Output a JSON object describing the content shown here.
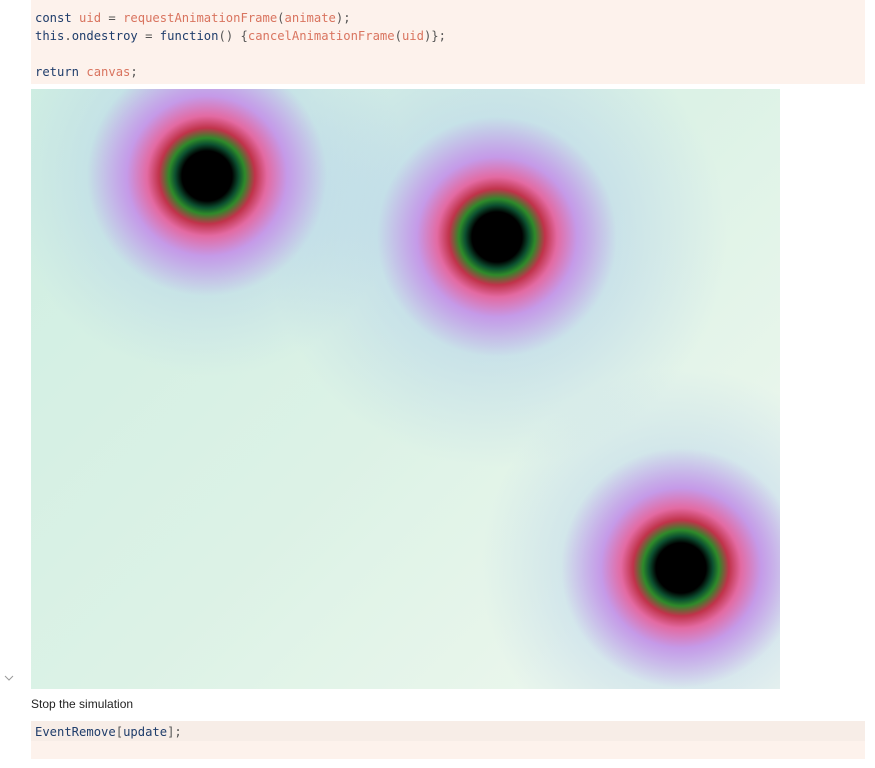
{
  "code_cell_1": {
    "line1_const": "const",
    "line1_uid": "uid",
    "line1_eq": "=",
    "line1_fn": "requestAnimationFrame",
    "line1_arg": "animate",
    "line2_this": "this",
    "line2_prop": "ondestroy",
    "line2_eq": "=",
    "line2_function": "function",
    "line2_paren": "()",
    "line2_cancel": "cancelAnimationFrame",
    "line2_arg": "uid",
    "line3_return": "return",
    "line3_canvas": "canvas"
  },
  "output_canvas": {
    "description_icon": "canvas-simulation"
  },
  "markdown": {
    "text": "Stop the simulation"
  },
  "code_cell_2": {
    "fn": "EventRemove",
    "arg": "update"
  },
  "icons": {
    "collapse": "chevron-down-icon"
  }
}
